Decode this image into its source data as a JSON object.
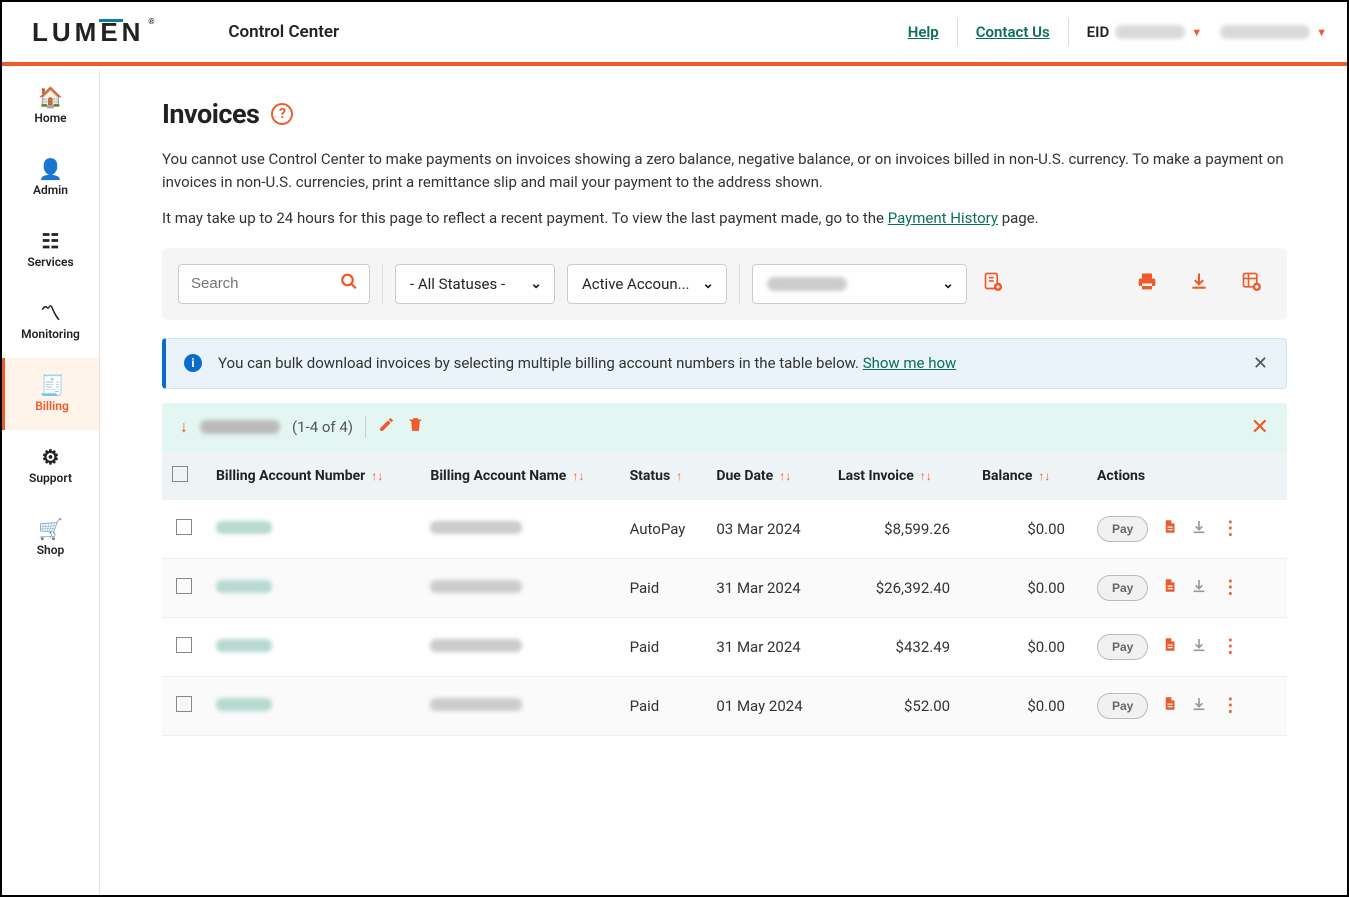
{
  "brand": "LUMEN",
  "appTitle": "Control Center",
  "header": {
    "help": "Help",
    "contact": "Contact Us",
    "eidLabel": "EID"
  },
  "sidebar": [
    {
      "id": "home",
      "label": "Home",
      "icon": "🏠"
    },
    {
      "id": "admin",
      "label": "Admin",
      "icon": "👤"
    },
    {
      "id": "services",
      "label": "Services",
      "icon": "☷"
    },
    {
      "id": "monitoring",
      "label": "Monitoring",
      "icon": "〽"
    },
    {
      "id": "billing",
      "label": "Billing",
      "icon": "🧾",
      "active": true
    },
    {
      "id": "support",
      "label": "Support",
      "icon": "⚙"
    },
    {
      "id": "shop",
      "label": "Shop",
      "icon": "🛒"
    }
  ],
  "page": {
    "title": "Invoices",
    "intro1a": "You cannot use Control Center to make payments on invoices showing a zero balance, negative balance, or on invoices billed in non-U.S. currency. To make a payment on invoices in non-U.S. currencies, print a remittance slip and mail your payment to the address shown.",
    "intro2a": "It may take up to 24 hours for this page to reflect a recent payment. To view the last payment made, go to the ",
    "intro2link": "Payment History",
    "intro2b": " page."
  },
  "filters": {
    "searchPlaceholder": "Search",
    "statusLabel": "- All Statuses -",
    "accountLabel": "Active Accoun..."
  },
  "info": {
    "text": "You can bulk download invoices by selecting multiple billing account numbers in the table below. ",
    "link": "Show me how"
  },
  "group": {
    "count": "(1-4 of 4)"
  },
  "table": {
    "headers": {
      "ban": "Billing Account Number",
      "baname": "Billing Account Name",
      "status": "Status",
      "due": "Due Date",
      "last": "Last Invoice",
      "balance": "Balance",
      "actions": "Actions"
    },
    "rows": [
      {
        "status": "AutoPay",
        "due": "03 Mar 2024",
        "last": "$8,599.26",
        "balance": "$0.00",
        "pay": "Pay"
      },
      {
        "status": "Paid",
        "due": "31 Mar 2024",
        "last": "$26,392.40",
        "balance": "$0.00",
        "pay": "Pay"
      },
      {
        "status": "Paid",
        "due": "31 Mar 2024",
        "last": "$432.49",
        "balance": "$0.00",
        "pay": "Pay"
      },
      {
        "status": "Paid",
        "due": "01 May 2024",
        "last": "$52.00",
        "balance": "$0.00",
        "pay": "Pay"
      }
    ]
  }
}
